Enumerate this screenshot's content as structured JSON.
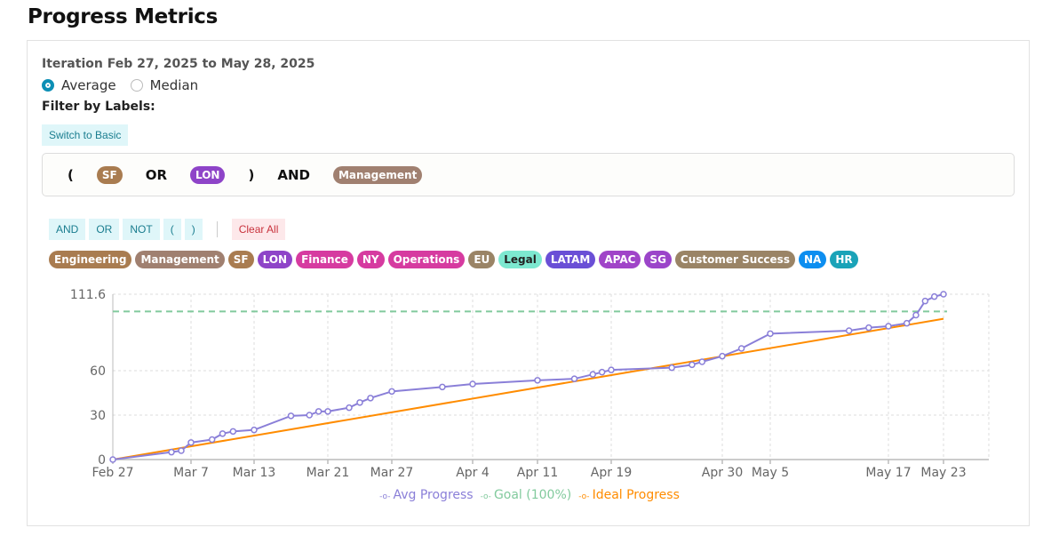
{
  "title": "Progress Metrics",
  "iteration": "Iteration Feb 27, 2025 to May 28, 2025",
  "mode": {
    "options": [
      "Average",
      "Median"
    ],
    "selected": "Average"
  },
  "filter_label": "Filter by Labels:",
  "switch_label": "Switch to Basic",
  "expression": [
    {
      "type": "op",
      "text": "("
    },
    {
      "type": "label",
      "text": "SF",
      "color": "#a97c50"
    },
    {
      "type": "op",
      "text": "OR"
    },
    {
      "type": "label",
      "text": "LON",
      "color": "#8e44c8"
    },
    {
      "type": "op",
      "text": ")"
    },
    {
      "type": "op",
      "text": "AND"
    },
    {
      "type": "label",
      "text": "Management",
      "color": "#a08070"
    }
  ],
  "operators": [
    "AND",
    "OR",
    "NOT",
    "(",
    ")"
  ],
  "clear_all": "Clear All",
  "labels": [
    {
      "text": "Engineering",
      "color": "#a97c50"
    },
    {
      "text": "Management",
      "color": "#a08070"
    },
    {
      "text": "SF",
      "color": "#a97c50"
    },
    {
      "text": "LON",
      "color": "#8e44c8"
    },
    {
      "text": "Finance",
      "color": "#d63ba0"
    },
    {
      "text": "NY",
      "color": "#d63ba0"
    },
    {
      "text": "Operations",
      "color": "#d63ba0"
    },
    {
      "text": "EU",
      "color": "#9a8466"
    },
    {
      "text": "Legal",
      "color": "#7de8d0",
      "dark": true
    },
    {
      "text": "LATAM",
      "color": "#6a4fd6"
    },
    {
      "text": "APAC",
      "color": "#a044c8"
    },
    {
      "text": "SG",
      "color": "#9b45c9"
    },
    {
      "text": "Customer Success",
      "color": "#9a8466"
    },
    {
      "text": "NA",
      "color": "#0d8ef0"
    },
    {
      "text": "HR",
      "color": "#1aa3b8"
    }
  ],
  "chart_data": {
    "type": "line",
    "xlabel": "",
    "ylabel": "",
    "x_ticks": [
      "Feb 27",
      "Mar 7",
      "Mar 13",
      "Mar 21",
      "Mar 27",
      "Apr 4",
      "Apr 11",
      "Apr 19",
      "Apr 30",
      "May 5",
      "May 17",
      "May 23"
    ],
    "y_ticks": [
      "0",
      "30",
      "60",
      "111.6"
    ],
    "ylim": [
      0,
      111.6
    ],
    "grid": true,
    "legend_position": "bottom",
    "series": [
      {
        "name": "Avg Progress",
        "color": "#8a7fd8",
        "x": [
          "Feb 27",
          "Mar 5",
          "Mar 6",
          "Mar 7",
          "Mar 9",
          "Mar 10",
          "Mar 11",
          "Mar 13",
          "Mar 17",
          "Mar 19",
          "Mar 20",
          "Mar 21",
          "Mar 23",
          "Mar 24",
          "Mar 25",
          "Mar 27",
          "Apr 1",
          "Apr 4",
          "Apr 11",
          "Apr 15",
          "Apr 17",
          "Apr 18",
          "Apr 19",
          "Apr 25",
          "Apr 27",
          "Apr 28",
          "Apr 30",
          "May 2",
          "May 5",
          "May 13",
          "May 15",
          "May 17",
          "May 19",
          "May 20",
          "May 21",
          "May 22",
          "May 23"
        ],
        "values": [
          0,
          5,
          6,
          11.5,
          13.5,
          17.5,
          19,
          20,
          29.5,
          30,
          32.5,
          32.5,
          35,
          38.5,
          41.5,
          46,
          49,
          51,
          53.5,
          54.5,
          57.5,
          59,
          60.5,
          62,
          64,
          66,
          69.8,
          75,
          85,
          87,
          89,
          90,
          92,
          97.5,
          107,
          110,
          111.6
        ]
      },
      {
        "name": "Goal (100%)",
        "color": "#82ca9d",
        "x": [
          "Feb 27",
          "May 23"
        ],
        "values": [
          100,
          100
        ]
      },
      {
        "name": "Ideal Progress",
        "color": "#ff8c00",
        "x": [
          "Feb 27",
          "May 23"
        ],
        "values": [
          0,
          95
        ]
      }
    ]
  }
}
